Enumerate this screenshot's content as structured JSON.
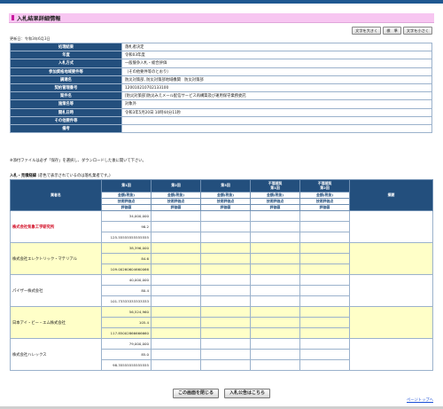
{
  "title": "入札結果詳細情報",
  "font_buttons": [
    "文字を大きく",
    "標　準",
    "文字を小さく"
  ],
  "update_date": "更新日：令和3年6月3日",
  "info_rows": [
    {
      "label": "処理結果",
      "value": "落札者決定"
    },
    {
      "label": "年度",
      "value": "令和03年度"
    },
    {
      "label": "入札方式",
      "value": "一般競争入札・総合評価"
    },
    {
      "label": "参加資格地域要件等",
      "value": "（その他要件等のとおり）"
    },
    {
      "label": "調達名",
      "value": "防災対策部, 防災対策部地域機関　防災対策部"
    },
    {
      "label": "契約管理番号",
      "value": "120010210702133100"
    },
    {
      "label": "案件名",
      "value": "[防災対策部]防災みえメール配信サービス再構築及び運用保守業務委託"
    },
    {
      "label": "施策名等",
      "value": "対象外"
    },
    {
      "label": "開札日時",
      "value": "令和3年5月20日 10時44分11秒"
    },
    {
      "label": "その他要件等",
      "value": ""
    },
    {
      "label": "備考",
      "value": ""
    }
  ],
  "attachment_note": "※添付ファイルは必ず「保存」を選択し、ダウンロードした後に開いて下さい。",
  "bid_section_title": "入札・見積経緯",
  "bid_section_note": "(赤色で表示されているのは落札業者です。)",
  "bid_table": {
    "header_company": "業者名",
    "rounds": [
      "第1回",
      "第2回",
      "第3回",
      "不落随契\n第1回",
      "不落随契\n第2回"
    ],
    "sub1": "金額(税抜)",
    "sub2": "技術評価点",
    "sub3": "評価値",
    "header_notes": "摘要",
    "rows": [
      {
        "name": "株式会社気象工学研究所",
        "amount": "34,000,000",
        "tech": "98.2",
        "score": "125.55555555555555",
        "winner": true,
        "highlight": false
      },
      {
        "name": "株式会社エレクトリック・マテリアル",
        "amount": "38,396,000",
        "tech": "84.6",
        "score": "109.00260604660066",
        "winner": false,
        "highlight": true
      },
      {
        "name": "パイザー株式会社",
        "amount": "40,000,000",
        "tech": "80.4",
        "score": "101.73333333333333",
        "winner": false,
        "highlight": false
      },
      {
        "name": "日本アイ・ビー・エム株式会社",
        "amount": "56,524,960",
        "tech": "105.4",
        "score": "117.85002866666660",
        "winner": false,
        "highlight": true
      },
      {
        "name": "株式会社ハレックス",
        "amount": "79,000,000",
        "tech": "85.0",
        "score": "98.35555555555555",
        "winner": false,
        "highlight": false
      }
    ]
  },
  "buttons": {
    "close": "この画面を閉じる",
    "notice": "入札公告はこちら"
  },
  "page_top": "ページトップへ",
  "colors": {
    "header": "#234f7d",
    "title_bg": "#f7c6f1",
    "highlight_row": "#ffffc8",
    "winner_text": "#d0021b"
  }
}
